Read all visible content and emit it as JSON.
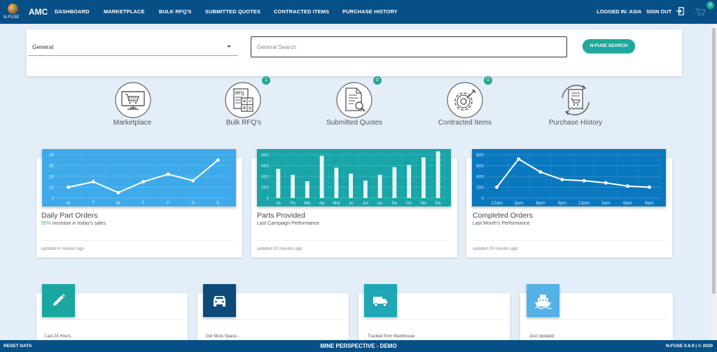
{
  "header": {
    "logo_text": "N-FUSE",
    "brand": "AMC",
    "nav": [
      {
        "label": "DASHBOARD"
      },
      {
        "label": "MARKETPLACE"
      },
      {
        "label": "BULK RFQ'S"
      },
      {
        "label": "SUBMITTED QUOTES"
      },
      {
        "label": "CONTRACTED ITEMS"
      },
      {
        "label": "PURCHASE HISTORY"
      }
    ],
    "logged_in": "LOGGED IN: ASIA",
    "sign_out": "SIGN OUT",
    "cart_count": "0"
  },
  "search": {
    "category": "General",
    "placeholder": "General Search",
    "button": "N-FUSE SEARCH"
  },
  "quick_links": [
    {
      "label": "Marketplace",
      "icon": "cart-monitor-icon",
      "badge": ""
    },
    {
      "label": "Bulk RFQ's",
      "icon": "rfq-calculator-icon",
      "badge": "1"
    },
    {
      "label": "Submitted Quotes",
      "icon": "document-search-icon",
      "badge": "0"
    },
    {
      "label": "Contracted Items",
      "icon": "gear-wrench-icon",
      "badge": "0"
    },
    {
      "label": "Purchase History",
      "icon": "history-receipt-icon",
      "badge": ""
    }
  ],
  "cards": [
    {
      "title": "Daily Part Orders",
      "percent": "55%",
      "sub": " increase in today's sales",
      "footer": "updated 4 minutes ago",
      "color": "#3eaaea"
    },
    {
      "title": "Parts Provided",
      "sub": "Last Campaign Performance",
      "footer": "updated 10 minutes ago",
      "color": "#17a5a8"
    },
    {
      "title": "Completed Orders",
      "sub": "Last Month's Performance",
      "footer": "updated 26 minutes ago",
      "color": "#0a78bf"
    }
  ],
  "bottom_cards": [
    {
      "footer": "Last 24 Hours",
      "icon": "pencil-icon",
      "color": "#19a7a0"
    },
    {
      "footer": "Get More Space...",
      "icon": "car-icon",
      "color": "#0d4a7a"
    },
    {
      "footer": "Tracked from Warehouse",
      "icon": "truck-icon",
      "color": "#1fa7b5"
    },
    {
      "footer": "Just Updated",
      "icon": "ship-icon",
      "color": "#54b2e6"
    }
  ],
  "footer_bar": {
    "reset": "RESET DATA",
    "center": "MINE PERSPECTIVE - DEMO",
    "version": "N-FUSE 0.0.9 | © 2020"
  },
  "chart_data": [
    {
      "type": "line",
      "categories": [
        "M",
        "T",
        "W",
        "T",
        "F",
        "S",
        "S"
      ],
      "values": [
        10,
        15,
        5,
        15,
        22,
        16,
        35
      ],
      "ylim": [
        0,
        40
      ],
      "yticks": [
        0,
        10,
        20,
        30,
        40
      ],
      "grid": true
    },
    {
      "type": "bar",
      "categories": [
        "Ja",
        "Fe",
        "Ma",
        "Ap",
        "Mai",
        "Ju",
        "Jul",
        "Au",
        "Se",
        "Oc",
        "No",
        "De"
      ],
      "values": [
        540,
        430,
        310,
        780,
        560,
        450,
        320,
        430,
        570,
        610,
        750,
        860
      ],
      "ylim": [
        0,
        800
      ],
      "yticks": [
        0,
        200,
        400,
        600,
        800
      ],
      "grid": true
    },
    {
      "type": "line",
      "categories": [
        "12am",
        "3pm",
        "6pm",
        "9pm",
        "12pm",
        "3am",
        "6am",
        "9am"
      ],
      "values": [
        200,
        720,
        480,
        340,
        320,
        280,
        220,
        200
      ],
      "ylim": [
        0,
        800
      ],
      "yticks": [
        0,
        200,
        400,
        600,
        800
      ],
      "grid": true
    }
  ]
}
